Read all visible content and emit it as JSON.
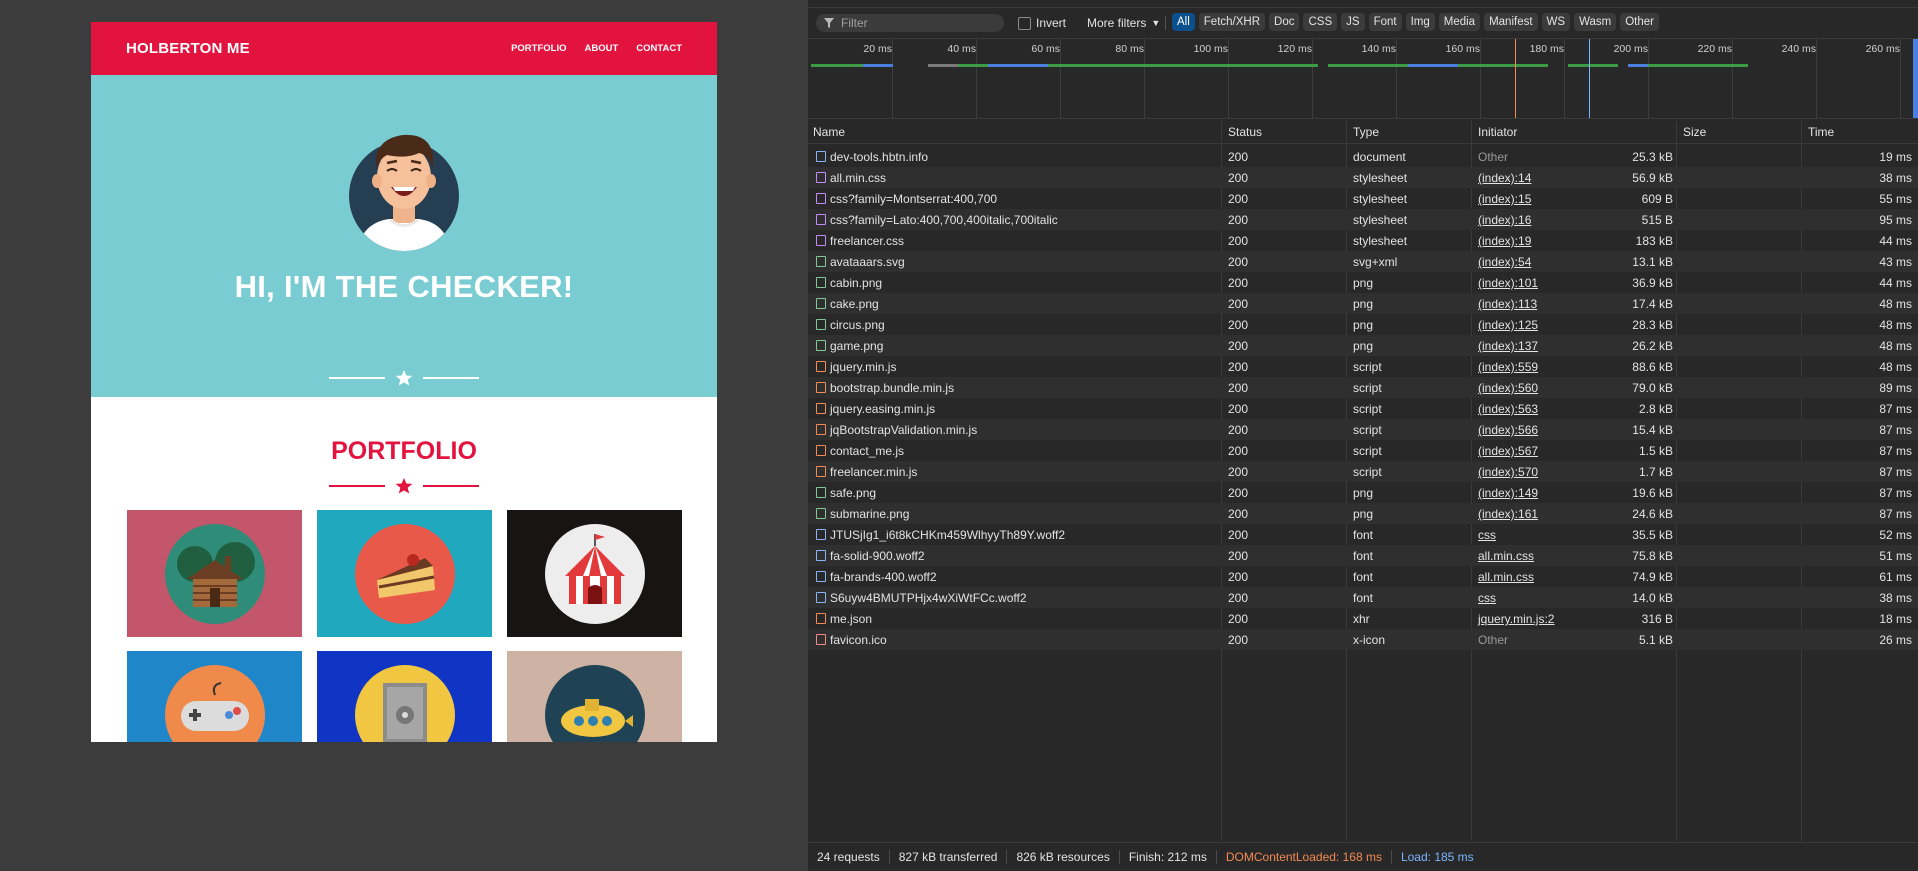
{
  "site": {
    "brand": "HOLBERTON ME",
    "nav": [
      "PORTFOLIO",
      "ABOUT",
      "CONTACT"
    ],
    "hero_title": "HI, I'M THE CHECKER!",
    "portfolio_title": "PORTFOLIO",
    "colors": {
      "primary": "#e3133f",
      "hero_bg": "#78ccd2"
    },
    "tiles": [
      {
        "name": "cabin",
        "bg": "#c4566b"
      },
      {
        "name": "cake",
        "bg": "#20a8bf"
      },
      {
        "name": "circus",
        "bg": "#181414"
      },
      {
        "name": "game",
        "bg": "#1f86c9"
      },
      {
        "name": "safe",
        "bg": "#1035c4"
      },
      {
        "name": "submarine",
        "bg": "#ceb2a4"
      }
    ]
  },
  "devtools": {
    "filter_placeholder": "Filter",
    "invert_label": "Invert",
    "more_filters": "More filters",
    "chips": [
      "All",
      "Fetch/XHR",
      "Doc",
      "CSS",
      "JS",
      "Font",
      "Img",
      "Media",
      "Manifest",
      "WS",
      "Wasm",
      "Other"
    ],
    "timeline_ticks": [
      "20 ms",
      "40 ms",
      "60 ms",
      "80 ms",
      "100 ms",
      "120 ms",
      "140 ms",
      "160 ms",
      "180 ms",
      "200 ms",
      "220 ms",
      "240 ms",
      "260 ms"
    ],
    "columns": [
      "Name",
      "Status",
      "Type",
      "Initiator",
      "Size",
      "Time"
    ],
    "requests": [
      {
        "name": "dev-tools.hbtn.info",
        "status": "200",
        "type": "document",
        "initiator": "Other",
        "size": "25.3 kB",
        "time": "19 ms",
        "icon": "doc"
      },
      {
        "name": "all.min.css",
        "status": "200",
        "type": "stylesheet",
        "initiator": "(index):14",
        "size": "56.9 kB",
        "time": "38 ms",
        "icon": "css"
      },
      {
        "name": "css?family=Montserrat:400,700",
        "status": "200",
        "type": "stylesheet",
        "initiator": "(index):15",
        "size": "609 B",
        "time": "55 ms",
        "icon": "css"
      },
      {
        "name": "css?family=Lato:400,700,400italic,700italic",
        "status": "200",
        "type": "stylesheet",
        "initiator": "(index):16",
        "size": "515 B",
        "time": "95 ms",
        "icon": "css"
      },
      {
        "name": "freelancer.css",
        "status": "200",
        "type": "stylesheet",
        "initiator": "(index):19",
        "size": "183 kB",
        "time": "44 ms",
        "icon": "css"
      },
      {
        "name": "avataaars.svg",
        "status": "200",
        "type": "svg+xml",
        "initiator": "(index):54",
        "size": "13.1 kB",
        "time": "43 ms",
        "icon": "img"
      },
      {
        "name": "cabin.png",
        "status": "200",
        "type": "png",
        "initiator": "(index):101",
        "size": "36.9 kB",
        "time": "44 ms",
        "icon": "img"
      },
      {
        "name": "cake.png",
        "status": "200",
        "type": "png",
        "initiator": "(index):113",
        "size": "17.4 kB",
        "time": "48 ms",
        "icon": "img"
      },
      {
        "name": "circus.png",
        "status": "200",
        "type": "png",
        "initiator": "(index):125",
        "size": "28.3 kB",
        "time": "48 ms",
        "icon": "img"
      },
      {
        "name": "game.png",
        "status": "200",
        "type": "png",
        "initiator": "(index):137",
        "size": "26.2 kB",
        "time": "48 ms",
        "icon": "img"
      },
      {
        "name": "jquery.min.js",
        "status": "200",
        "type": "script",
        "initiator": "(index):559",
        "size": "88.6 kB",
        "time": "48 ms",
        "icon": "js"
      },
      {
        "name": "bootstrap.bundle.min.js",
        "status": "200",
        "type": "script",
        "initiator": "(index):560",
        "size": "79.0 kB",
        "time": "89 ms",
        "icon": "js"
      },
      {
        "name": "jquery.easing.min.js",
        "status": "200",
        "type": "script",
        "initiator": "(index):563",
        "size": "2.8 kB",
        "time": "87 ms",
        "icon": "js"
      },
      {
        "name": "jqBootstrapValidation.min.js",
        "status": "200",
        "type": "script",
        "initiator": "(index):566",
        "size": "15.4 kB",
        "time": "87 ms",
        "icon": "js"
      },
      {
        "name": "contact_me.js",
        "status": "200",
        "type": "script",
        "initiator": "(index):567",
        "size": "1.5 kB",
        "time": "87 ms",
        "icon": "js"
      },
      {
        "name": "freelancer.min.js",
        "status": "200",
        "type": "script",
        "initiator": "(index):570",
        "size": "1.7 kB",
        "time": "87 ms",
        "icon": "js"
      },
      {
        "name": "safe.png",
        "status": "200",
        "type": "png",
        "initiator": "(index):149",
        "size": "19.6 kB",
        "time": "87 ms",
        "icon": "img"
      },
      {
        "name": "submarine.png",
        "status": "200",
        "type": "png",
        "initiator": "(index):161",
        "size": "24.6 kB",
        "time": "87 ms",
        "icon": "img"
      },
      {
        "name": "JTUSjIg1_i6t8kCHKm459WlhyyTh89Y.woff2",
        "status": "200",
        "type": "font",
        "initiator": "css",
        "size": "35.5 kB",
        "time": "52 ms",
        "icon": "font"
      },
      {
        "name": "fa-solid-900.woff2",
        "status": "200",
        "type": "font",
        "initiator": "all.min.css",
        "size": "75.8 kB",
        "time": "51 ms",
        "icon": "font"
      },
      {
        "name": "fa-brands-400.woff2",
        "status": "200",
        "type": "font",
        "initiator": "all.min.css",
        "size": "74.9 kB",
        "time": "61 ms",
        "icon": "font"
      },
      {
        "name": "S6uyw4BMUTPHjx4wXiWtFCc.woff2",
        "status": "200",
        "type": "font",
        "initiator": "css",
        "size": "14.0 kB",
        "time": "38 ms",
        "icon": "font"
      },
      {
        "name": "me.json",
        "status": "200",
        "type": "xhr",
        "initiator": "jquery.min.js:2",
        "size": "316 B",
        "time": "18 ms",
        "icon": "xhr"
      },
      {
        "name": "favicon.ico",
        "status": "200",
        "type": "x-icon",
        "initiator": "Other",
        "size": "5.1 kB",
        "time": "26 ms",
        "icon": "err"
      }
    ],
    "status_bar": {
      "requests": "24 requests",
      "transferred": "827 kB transferred",
      "resources": "826 kB resources",
      "finish": "Finish: 212 ms",
      "dcl": "DOMContentLoaded: 168 ms",
      "load": "Load: 185 ms"
    },
    "colors": {
      "dcl": "#f28b54",
      "load": "#7ab6ff",
      "accent": "#0b4f8c"
    }
  }
}
